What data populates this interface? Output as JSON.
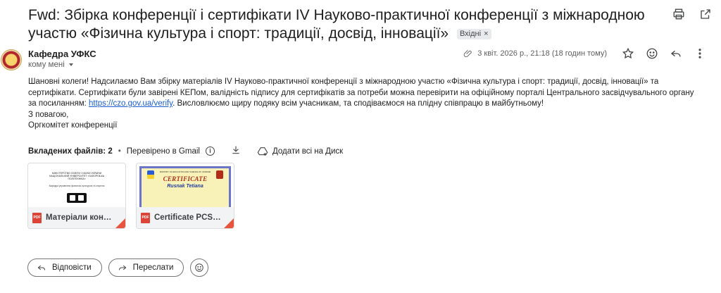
{
  "subject": {
    "text": "Fwd: Збірка конференції і сертифікати IV Науково-практичної конференції з міжнародною участю «Фізична культура і спорт: традиції, досвід, інновації»",
    "label_chip": "Вхідні",
    "label_remove": "×"
  },
  "sender": {
    "name": "Кафедра УФКС",
    "to": "кому мені"
  },
  "meta": {
    "date": "3 квіт. 2026 р., 21:18 (18 годин тому)"
  },
  "body": {
    "p1_before_link": "Шановні колеги! Надсилаємо Вам збірку матеріалів IV Науково-практичної конференції з міжнародною участю «Фізична культура і спорт: традиції, досвід, інновації» та сертифікати. Сертифікати були завірені КЕПом, валідність підпису для сертифікатів за потреби можна перевірити на офіційному порталі Центрального засвідчувального органу за посиланням: ",
    "link": "https://czo.gov.ua/verify",
    "p1_after_link": ". Висловлюємо щиру подяку всім учасникам, та сподіваємося на плідну співпрацю в майбутньому!",
    "greeting": "З повагою,",
    "signature": "Оргкомітет конференції"
  },
  "attachments": {
    "count_label": "Вкладених файлів: 2",
    "scanned": "Перевірено в Gmail",
    "add_all": "Додати всі на Диск",
    "files": [
      {
        "name": "Матеріали конфер...",
        "type": "PDF"
      },
      {
        "name": "Certificate PCSM ...",
        "type": "PDF"
      }
    ],
    "cert_preview": {
      "header": "MINISTRY OF EDUCATION AND SCIENCE OF UKRAINE",
      "title": "CERTIFICATE",
      "name": "Rusnak Tetiana"
    },
    "doc_preview": {
      "line1": "МІНІСТЕРСТВО ОСВІТИ І НАУКИ УКРАЇНИ",
      "line2": "НАЦІОНАЛЬНИЙ УНІВЕРСИТЕТ «ЗАПОРІЗЬКА ПОЛІТЕХНІКА»",
      "line3": "Кафедра управління фізичною культурою та спортом"
    }
  },
  "actions": {
    "reply": "Відповісти",
    "forward": "Переслати"
  }
}
